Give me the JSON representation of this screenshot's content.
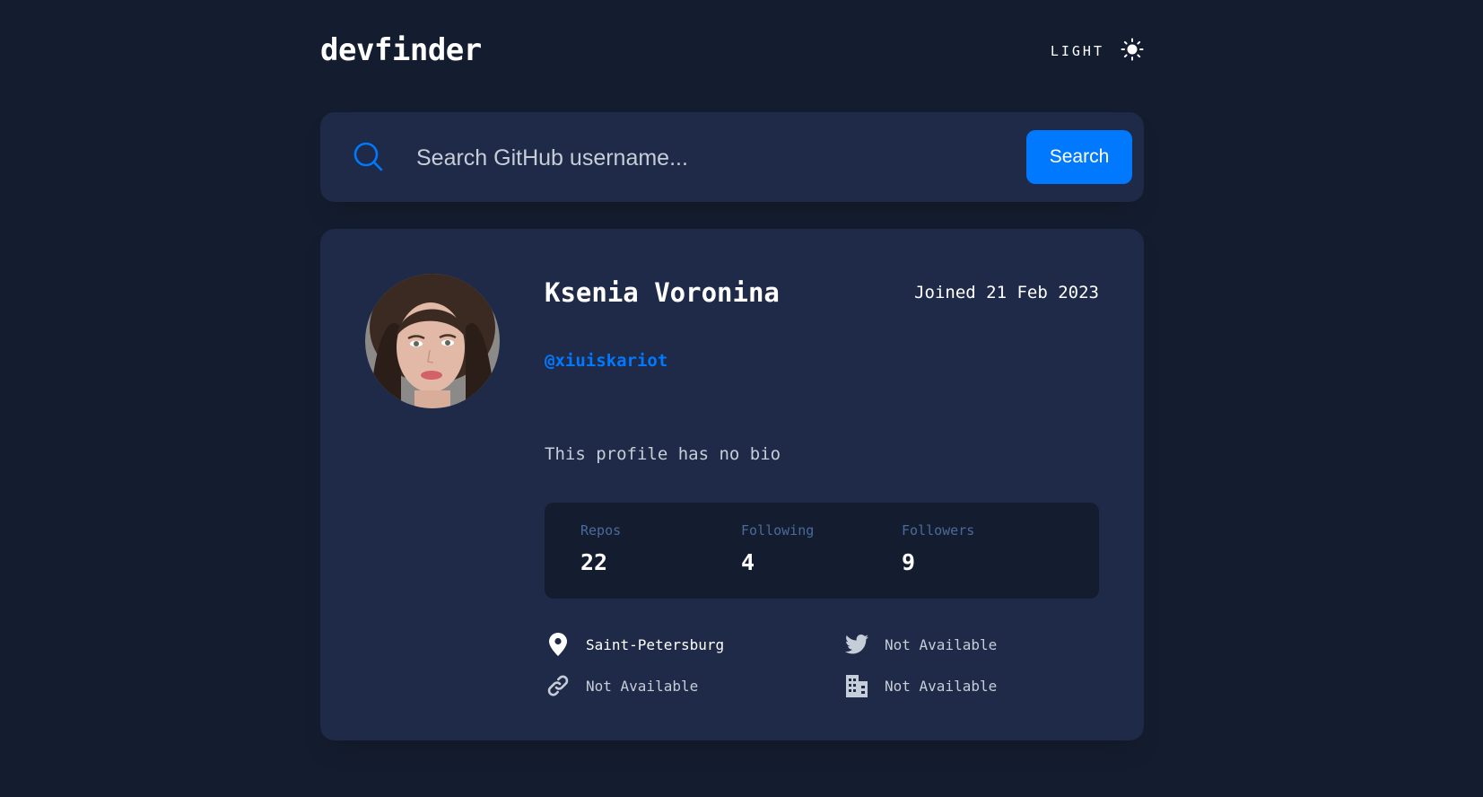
{
  "header": {
    "logo": "devfinder",
    "theme_label": "LIGHT",
    "theme_icon": "sun-icon"
  },
  "search": {
    "placeholder": "Search GitHub username...",
    "value": "",
    "button_label": "Search",
    "icon": "search-icon"
  },
  "profile": {
    "name": "Ksenia Voronina",
    "joined": "Joined 21 Feb 2023",
    "login": "@xiuiskariot",
    "bio": "This profile has no bio",
    "stats": [
      {
        "label": "Repos",
        "value": "22"
      },
      {
        "label": "Following",
        "value": "4"
      },
      {
        "label": "Followers",
        "value": "9"
      }
    ],
    "links": {
      "location": "Saint-Petersburg",
      "twitter": "Not Available",
      "blog": "Not Available",
      "company": "Not Available"
    }
  },
  "colors": {
    "background": "#141d2f",
    "card": "#1e2a47",
    "accent": "#0079ff",
    "muted": "#4b6a9b",
    "text": "#ffffff"
  }
}
